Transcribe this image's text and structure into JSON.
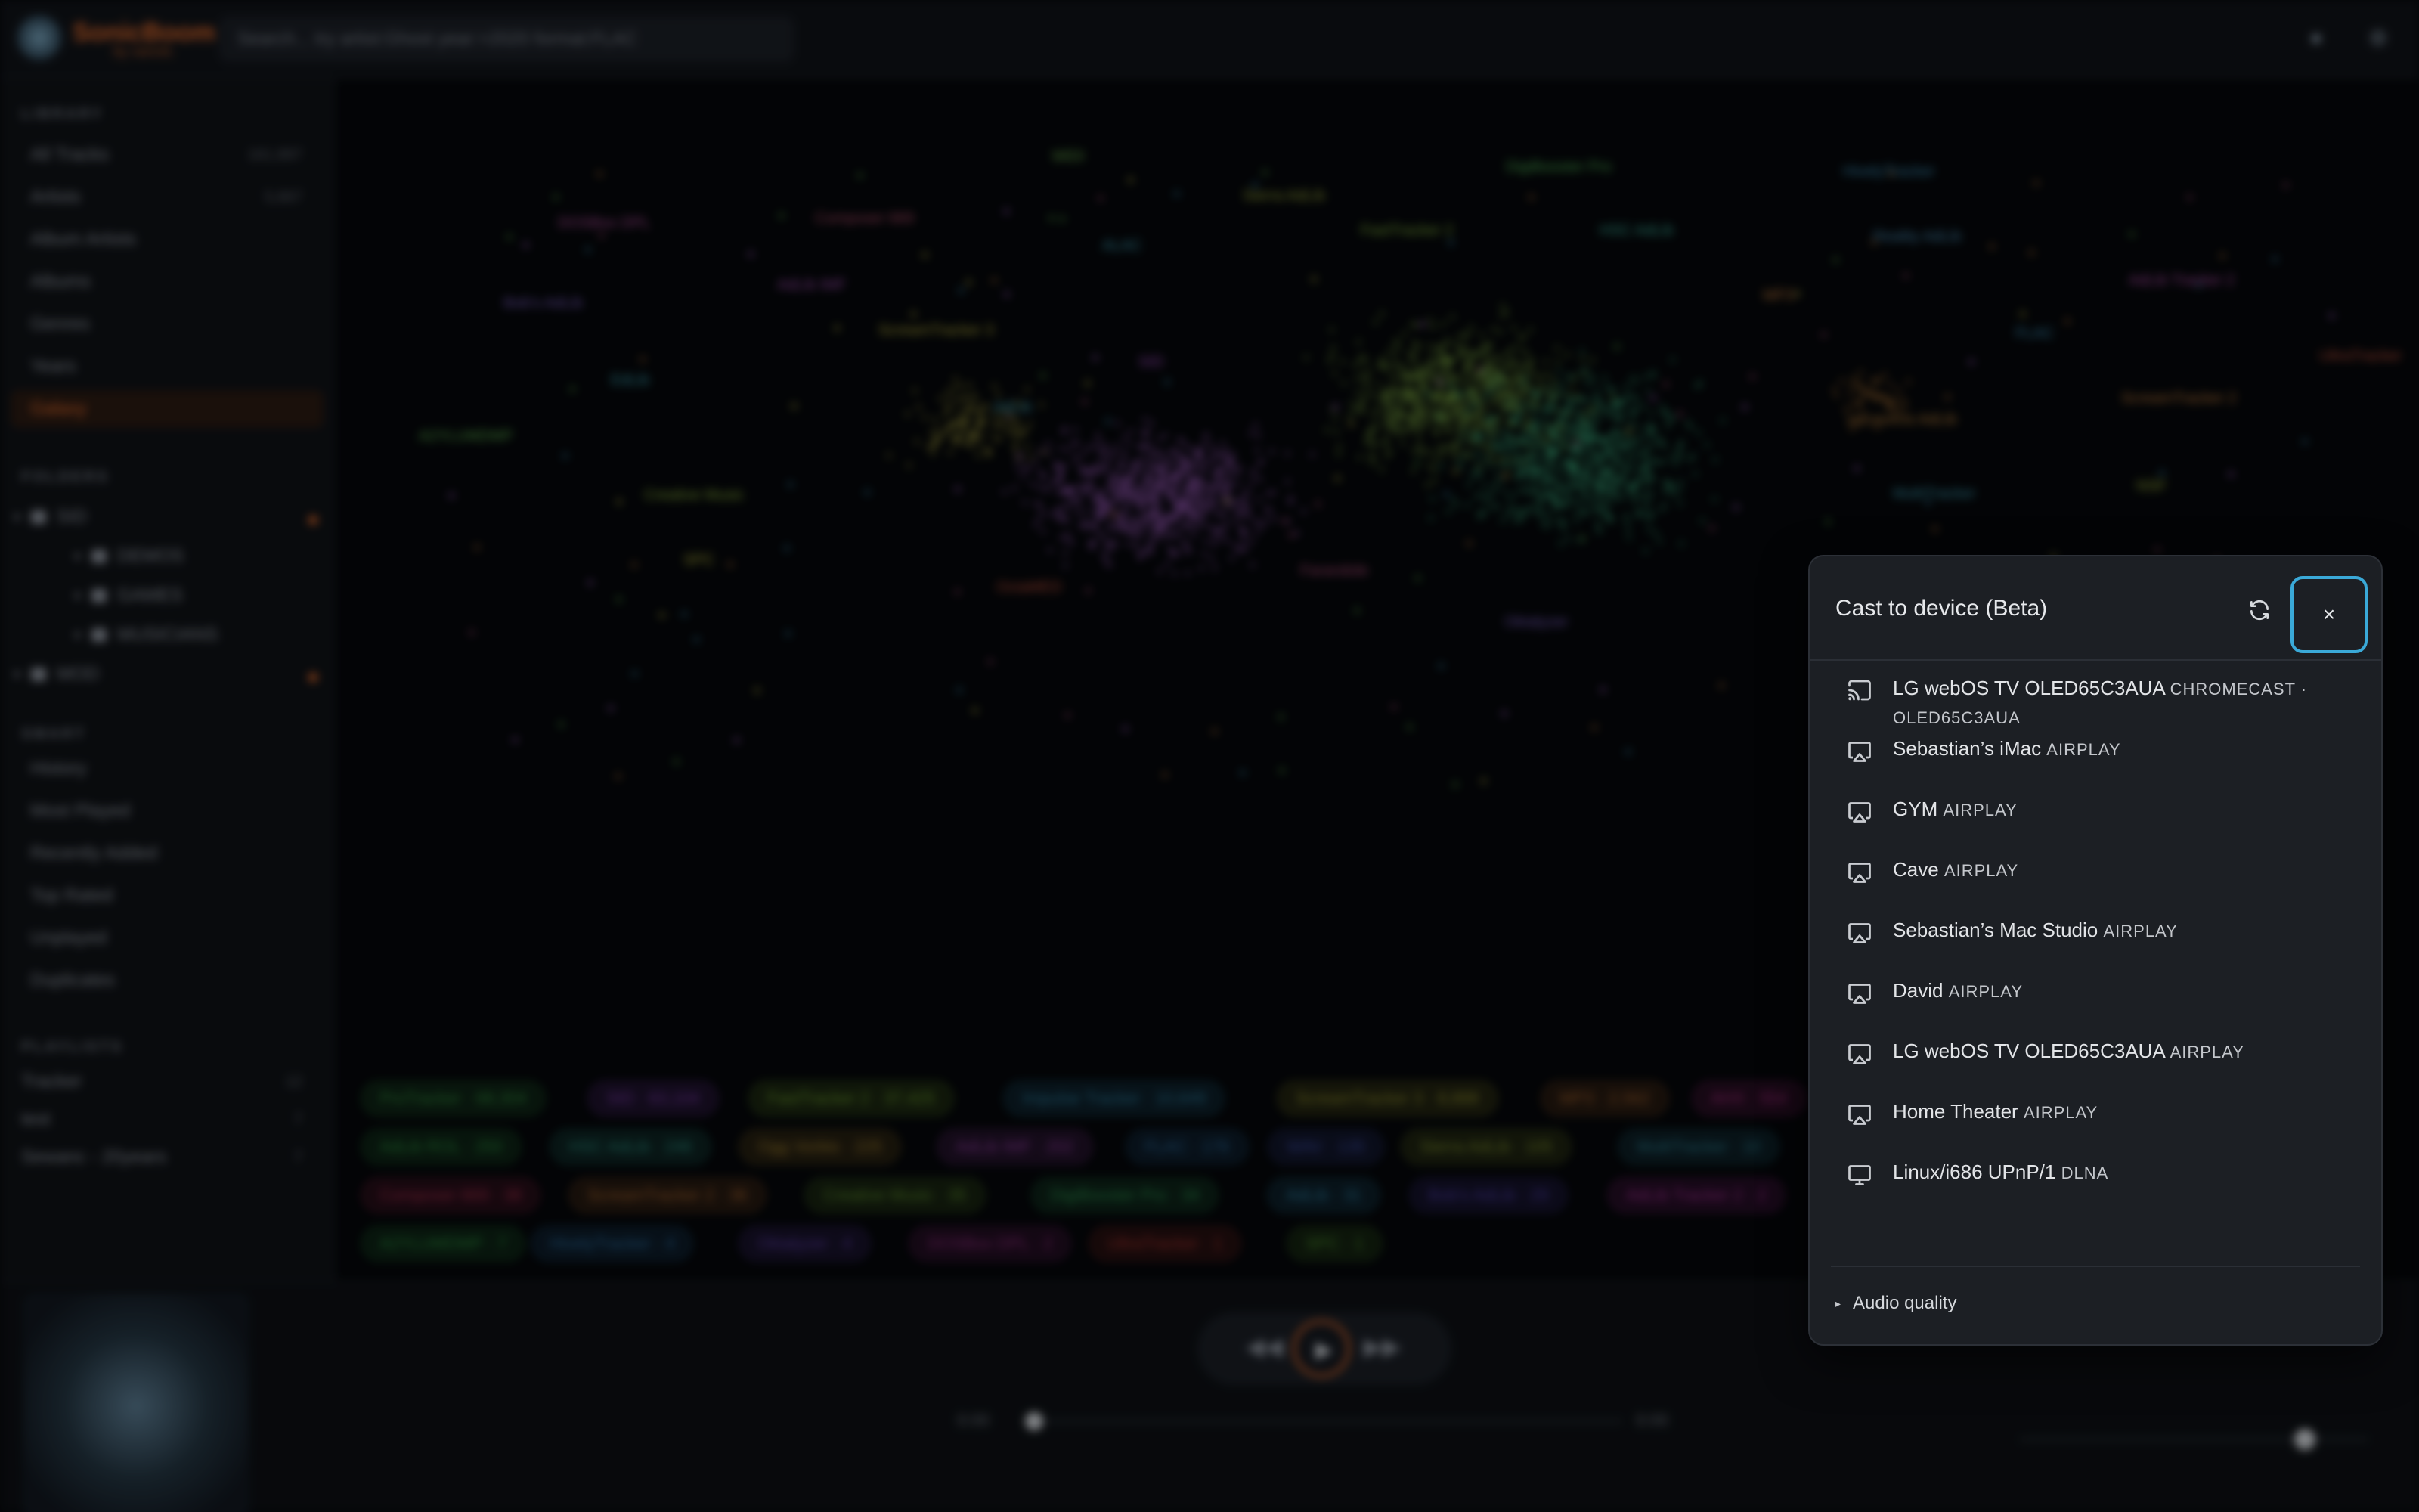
{
  "app": {
    "brand": "SonicBoom",
    "brand_sub": "by xanclic",
    "search_placeholder": "Search... try artist:Ghost year:>2020 format:FLAC"
  },
  "sidebar": {
    "library_heading": "LIBRARY",
    "library": [
      {
        "label": "All Tracks",
        "count": "161,887"
      },
      {
        "label": "Artists",
        "count": "5,867"
      },
      {
        "label": "Album Artists",
        "count": ""
      },
      {
        "label": "Albums",
        "count": ""
      },
      {
        "label": "Genres",
        "count": ""
      },
      {
        "label": "Years",
        "count": ""
      },
      {
        "label": "Galaxy",
        "count": ""
      }
    ],
    "folders_heading": "FOLDERS",
    "folders": [
      "SID",
      "DEMOS",
      "GAMES",
      "MUSICIANS",
      "MOD"
    ],
    "smart_heading": "SMART",
    "smart": [
      "History",
      "Most Played",
      "Recently Added",
      "Top Rated",
      "Unplayed",
      "Duplicates"
    ],
    "playlists_heading": "PLAYLISTS",
    "playlists": [
      {
        "label": "Tracker",
        "count": "12"
      },
      {
        "label": "test",
        "count": "7"
      },
      {
        "label": "Sewanc - 20years",
        "count": "7"
      }
    ]
  },
  "galaxy": {
    "labels": [
      {
        "text": "MIDI",
        "color": "#6ab04c"
      },
      {
        "text": "DigiBooster Pro",
        "color": "#4caf50"
      },
      {
        "text": "HivelyTracker",
        "color": "#3a8fb7"
      },
      {
        "text": "DOSBox DPL",
        "color": "#b04c9a"
      },
      {
        "text": "Composer 669",
        "color": "#b04c6a"
      },
      {
        "text": "Sierra AdLib",
        "color": "#9aa83a"
      },
      {
        "text": "FastTracker 2",
        "color": "#7fb03a"
      },
      {
        "text": "HSC AdLib",
        "color": "#3ab09a"
      },
      {
        "text": "Reality AdLib",
        "color": "#4a8fb7"
      },
      {
        "text": "Bob's AdLib",
        "color": "#7a5cc0"
      },
      {
        "text": "AdLib IMF",
        "color": "#a04cb0"
      },
      {
        "text": "ALAC",
        "color": "#3a9ab0"
      },
      {
        "text": "MP3",
        "color": "#c07a3a"
      },
      {
        "text": "AdLib Tracker 2",
        "color": "#b04ca8"
      },
      {
        "text": "ScreamTracker 3",
        "color": "#b0a83a"
      },
      {
        "text": "SID",
        "color": "#a04cc0"
      },
      {
        "text": "FLAC",
        "color": "#3a8fb7"
      },
      {
        "text": "UltraTracker",
        "color": "#c0503a"
      },
      {
        "text": "EdLib",
        "color": "#3aa0b0"
      },
      {
        "text": "ScreamTracker 2",
        "color": "#c07a3a"
      },
      {
        "text": "LucasArts AdLib",
        "color": "#c0843a"
      },
      {
        "text": "A2YLUMDMP",
        "color": "#5ab04c"
      },
      {
        "text": "Creative Music",
        "color": "#8ab03a"
      },
      {
        "text": "MultiTracker",
        "color": "#3a9ab0"
      },
      {
        "text": "NSF",
        "color": "#9ab03a"
      },
      {
        "text": "SPC",
        "color": "#b0b03a"
      },
      {
        "text": "OctaMED",
        "color": "#c0503a"
      },
      {
        "text": "Farandole",
        "color": "#b04c7a"
      },
      {
        "text": "Oktalyzer",
        "color": "#7a5cc0"
      },
      {
        "text": "AdLib",
        "color": "#3a9ab0"
      }
    ]
  },
  "format_chips": [
    {
      "label": "ProTracker · 68,304",
      "color": "#2f8a3a"
    },
    {
      "label": "SID · 63,104",
      "color": "#7a3aa8"
    },
    {
      "label": "FastTracker 2 · 37,425",
      "color": "#6a9a2a"
    },
    {
      "label": "Impulse Tracker · 10,649",
      "color": "#2a7a9a"
    },
    {
      "label": "ScreamTracker 3 · 8,888",
      "color": "#8a8a2a"
    },
    {
      "label": "MP3 · 2,562",
      "color": "#a0602a"
    },
    {
      "label": "AHX · 554",
      "color": "#a02a7a"
    },
    {
      "label": "AdLib ROL · 250",
      "color": "#2a8a3a"
    },
    {
      "label": "HSC AdLib · 246",
      "color": "#2a8a7a"
    },
    {
      "label": "Ogg Vorbis · 225",
      "color": "#9a7a2a"
    },
    {
      "label": "AdLib IMF · 202",
      "color": "#8a3a9a"
    },
    {
      "label": "FLAC · 176",
      "color": "#2a6a9a"
    },
    {
      "label": "WAV · 135",
      "color": "#3a4aa0"
    },
    {
      "label": "Sierra AdLib · 105",
      "color": "#7a8a2a"
    },
    {
      "label": "MultiTracker · 10",
      "color": "#2a7a8a"
    },
    {
      "label": "Composer 669 · 38",
      "color": "#a02a4a"
    },
    {
      "label": "ScreamTracker 2 · 36",
      "color": "#a0602a"
    },
    {
      "label": "Creative Music · 35",
      "color": "#5a8a2a"
    },
    {
      "label": "DigiBooster Pro · 34",
      "color": "#2a8a4a"
    },
    {
      "label": "AdLib · 31",
      "color": "#2a7a9a"
    },
    {
      "label": "Bob's AdLib · 29",
      "color": "#4a3aa0"
    },
    {
      "label": "AdLib Tracker 2 · 2",
      "color": "#9a2a8a"
    },
    {
      "label": "A2YLUMDMP · 7",
      "color": "#2a8a3a"
    },
    {
      "label": "HivelyTracker · 4",
      "color": "#2a6a9a"
    },
    {
      "label": "Oktalyzer · 4",
      "color": "#5a3aa0"
    },
    {
      "label": "DOSBox DPL · 2",
      "color": "#8a2a7a"
    },
    {
      "label": "UltraTracker · 1",
      "color": "#a0302a"
    },
    {
      "label": "SPC · 1",
      "color": "#4a8a2a"
    }
  ],
  "player": {
    "time_current": "0:00",
    "time_total": "0:00",
    "progress": 0,
    "volume": 0.82
  },
  "cast_dialog": {
    "title": "Cast to device (Beta)",
    "close_label": "×",
    "devices": [
      {
        "name": "LG webOS TV OLED65C3AUA",
        "protocol": "CHROMECAST · OLED65C3AUA",
        "icon": "cast-icon"
      },
      {
        "name": "Sebastian’s iMac",
        "protocol": "AIRPLAY",
        "icon": "airplay-icon"
      },
      {
        "name": "GYM",
        "protocol": "AIRPLAY",
        "icon": "airplay-icon"
      },
      {
        "name": "Cave",
        "protocol": "AIRPLAY",
        "icon": "airplay-icon"
      },
      {
        "name": "Sebastian’s Mac Studio",
        "protocol": "AIRPLAY",
        "icon": "airplay-icon"
      },
      {
        "name": "David",
        "protocol": "AIRPLAY",
        "icon": "airplay-icon"
      },
      {
        "name": "LG webOS TV OLED65C3AUA",
        "protocol": "AIRPLAY",
        "icon": "airplay-icon"
      },
      {
        "name": "Home Theater",
        "protocol": "AIRPLAY",
        "icon": "airplay-icon"
      },
      {
        "name": "Linux/i686 UPnP/1",
        "protocol": "DLNA",
        "icon": "monitor-icon"
      }
    ],
    "audio_quality_label": "Audio quality"
  },
  "colors": {
    "accent": "#e2692a",
    "focus_ring": "#3aa9d8",
    "dialog_bg": "#1c1f24"
  }
}
